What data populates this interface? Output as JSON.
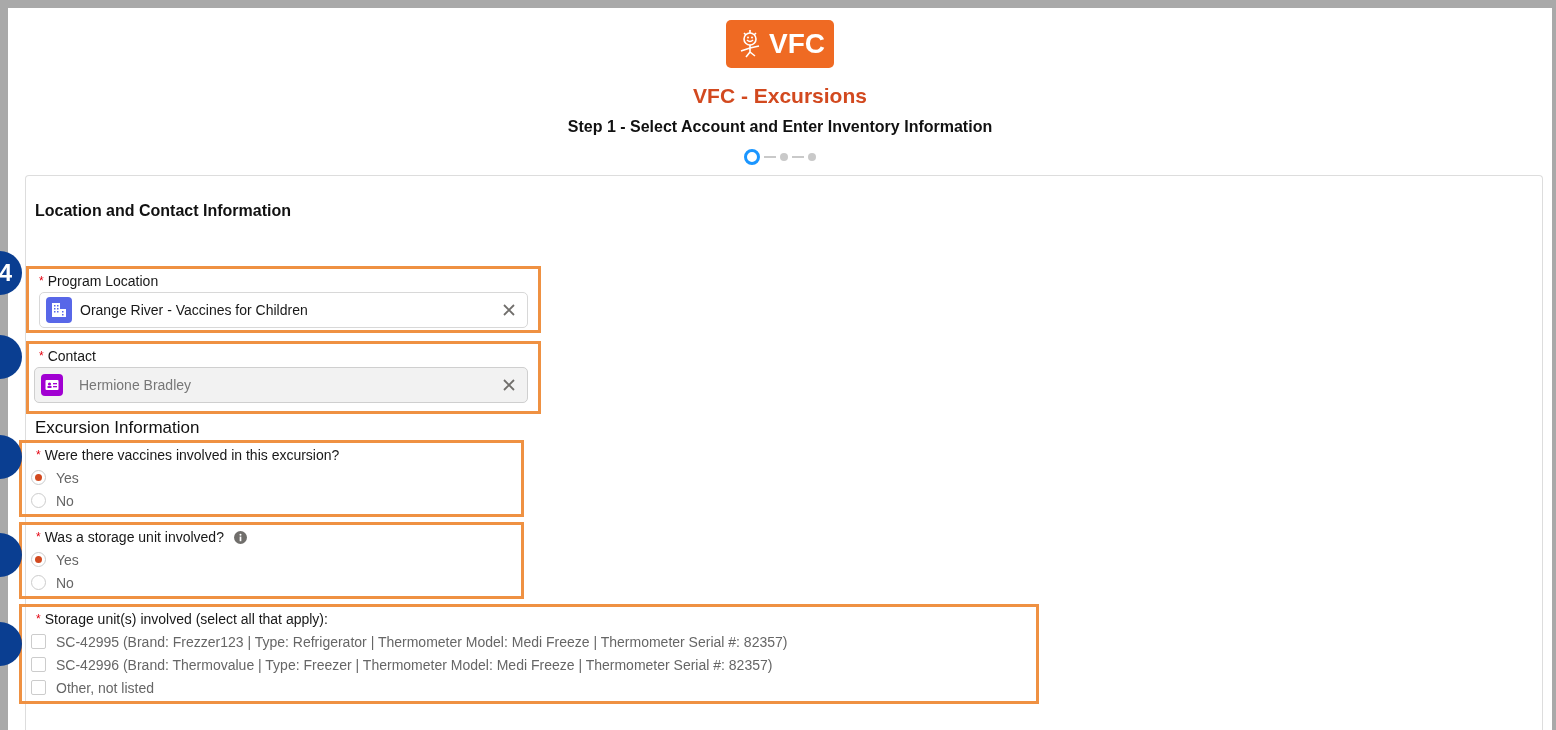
{
  "logo": {
    "text": "VFC"
  },
  "title": "VFC - Excursions",
  "step_title": "Step 1 - Select Account and Enter Inventory Information",
  "progress": [
    {
      "selected": true
    },
    {
      "selected": false
    },
    {
      "selected": false
    }
  ],
  "section_title": "Location and Contact Information",
  "callouts": [
    {
      "kind": "numbered",
      "label": "4"
    },
    {
      "kind": "blank"
    },
    {
      "kind": "blank"
    },
    {
      "kind": "blank"
    },
    {
      "kind": "blank"
    }
  ],
  "fields": [
    {
      "kind": "lookup",
      "label": "Program Location",
      "required": "*",
      "value": "Orange River - Vaccines for Children",
      "disabled": false
    },
    {
      "kind": "lookup",
      "label": "Contact",
      "required": "*",
      "value": "Hermione Bradley",
      "disabled": true
    },
    {
      "kind": "heading",
      "label": "Excursion Information"
    },
    {
      "kind": "radio",
      "label": "Were there vaccines involved in this excursion?",
      "required": "*",
      "options": [
        {
          "label": "Yes",
          "selected": true
        },
        {
          "label": "No",
          "selected": false
        }
      ]
    },
    {
      "kind": "radio",
      "label": "Was a storage unit involved?",
      "required": "*",
      "info": true,
      "options": [
        {
          "label": "Yes",
          "selected": true
        },
        {
          "label": "No",
          "selected": false
        }
      ]
    },
    {
      "kind": "checkbox",
      "label": "Storage unit(s) involved (select all that apply):",
      "required": "*",
      "options": [
        {
          "label": "SC-42995 (Brand: Frezzer123 | Type: Refrigerator | Thermometer Model: Medi Freeze | Thermometer Serial #: 82357)",
          "checked": false
        },
        {
          "label": "SC-42996 (Brand: Thermovalue | Type: Freezer | Thermometer Model: Medi Freeze | Thermometer Serial #: 82357)",
          "checked": false
        },
        {
          "label": "Other, not listed",
          "checked": false
        }
      ]
    }
  ]
}
